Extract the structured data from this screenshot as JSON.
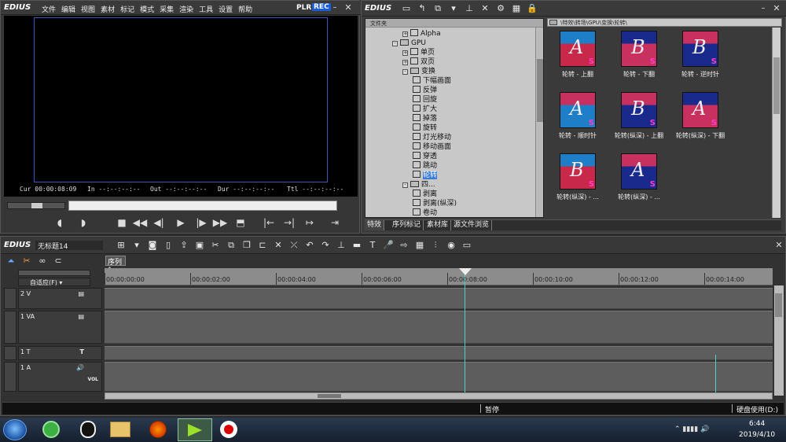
{
  "player": {
    "logo": "EDIUS",
    "menu": [
      "文件",
      "编辑",
      "视图",
      "素材",
      "标记",
      "模式",
      "采集",
      "渲染",
      "工具",
      "设置",
      "帮助"
    ],
    "plr": "PLR",
    "rec": "REC",
    "cur_label": "Cur",
    "cur_value": "00:00:08:09",
    "in_label": "In",
    "in_value": "--:--:--:--",
    "out_label": "Out",
    "out_value": "--:--:--:--",
    "dur_label": "Dur",
    "dur_value": "--:--:--:--",
    "ttl_label": "Ttl",
    "ttl_value": "--:--:--:--"
  },
  "effects": {
    "logo": "EDIUS",
    "folder_header": "文件夹",
    "breadcrumb": "\\特效\\转场\\GPU\\变换\\轮转\\",
    "tree": [
      {
        "label": "Alpha",
        "indent": 3,
        "kind": "fx",
        "sign": "+"
      },
      {
        "label": "GPU",
        "indent": 2,
        "kind": "folder",
        "sign": "-"
      },
      {
        "label": "单页",
        "indent": 3,
        "kind": "fx",
        "sign": "+"
      },
      {
        "label": "双页",
        "indent": 3,
        "kind": "fx",
        "sign": "+"
      },
      {
        "label": "变换",
        "indent": 3,
        "kind": "folder",
        "sign": "-"
      },
      {
        "label": "下幅画面",
        "indent": 4,
        "kind": "fx",
        "sign": ""
      },
      {
        "label": "反弹",
        "indent": 4,
        "kind": "fx",
        "sign": ""
      },
      {
        "label": "回旋",
        "indent": 4,
        "kind": "fx",
        "sign": ""
      },
      {
        "label": "扩大",
        "indent": 4,
        "kind": "fx",
        "sign": ""
      },
      {
        "label": "掉落",
        "indent": 4,
        "kind": "fx",
        "sign": ""
      },
      {
        "label": "旋转",
        "indent": 4,
        "kind": "fx",
        "sign": ""
      },
      {
        "label": "灯光移动",
        "indent": 4,
        "kind": "fx",
        "sign": ""
      },
      {
        "label": "移动画面",
        "indent": 4,
        "kind": "fx",
        "sign": ""
      },
      {
        "label": "穿透",
        "indent": 4,
        "kind": "fx",
        "sign": ""
      },
      {
        "label": "跳动",
        "indent": 4,
        "kind": "fx",
        "sign": ""
      },
      {
        "label": "轮转",
        "indent": 4,
        "kind": "fx",
        "sign": "",
        "selected": true
      },
      {
        "label": "四...",
        "indent": 3,
        "kind": "folder",
        "sign": "-"
      },
      {
        "label": "剥离",
        "indent": 4,
        "kind": "fx",
        "sign": ""
      },
      {
        "label": "剥离(纵深)",
        "indent": 4,
        "kind": "fx",
        "sign": ""
      },
      {
        "label": "卷动",
        "indent": 4,
        "kind": "fx",
        "sign": ""
      },
      {
        "label": "卷动(纵深)",
        "indent": 4,
        "kind": "fx",
        "sign": ""
      }
    ],
    "thumbs": [
      {
        "label": "轮转 - 上翻",
        "letter": "A",
        "style": "a"
      },
      {
        "label": "轮转 - 下翻",
        "letter": "B",
        "style": "b"
      },
      {
        "label": "轮转 - 逆时针",
        "letter": "B",
        "style": "c"
      },
      {
        "label": "轮转 - 顺时针",
        "letter": "A",
        "style": "d"
      },
      {
        "label": "轮转(纵深) - 上翻",
        "letter": "B",
        "style": "e"
      },
      {
        "label": "轮转(纵深) - 下翻",
        "letter": "A",
        "style": "f"
      },
      {
        "label": "轮转(纵深) - ...",
        "letter": "B",
        "style": "g"
      },
      {
        "label": "轮转(纵深) - ...",
        "letter": "A",
        "style": "h"
      }
    ],
    "tabs": [
      "特效",
      "序列标记",
      "素材库",
      "源文件浏览"
    ]
  },
  "timeline": {
    "logo": "EDIUS",
    "project": "无标题14",
    "sequence_tab": "序列1",
    "ruler": [
      "00:00:00:00",
      "00:00:02:00",
      "00:00:04:00",
      "00:00:06:00",
      "00:00:08:00",
      "00:00:10:00",
      "00:00:12:00",
      "00:00:14:00"
    ],
    "fit_label": "自适应(F)",
    "tracks": [
      {
        "name": "2 V",
        "kind": "V"
      },
      {
        "name": "1 VA",
        "kind": "VA"
      },
      {
        "name": "1 T",
        "kind": "T"
      },
      {
        "name": "1 A",
        "kind": "A",
        "vol": "VOL"
      }
    ]
  },
  "status": {
    "state": "暂停",
    "disk": "硬盘使用(D:)"
  },
  "taskbar": {
    "time": "6:44",
    "date": "2019/4/10"
  },
  "colors": {
    "rec": "#1a5bd8",
    "selected": "#3a7ad8",
    "monitor_border": "#3a55c0",
    "playhead": "#4fd0c8"
  }
}
